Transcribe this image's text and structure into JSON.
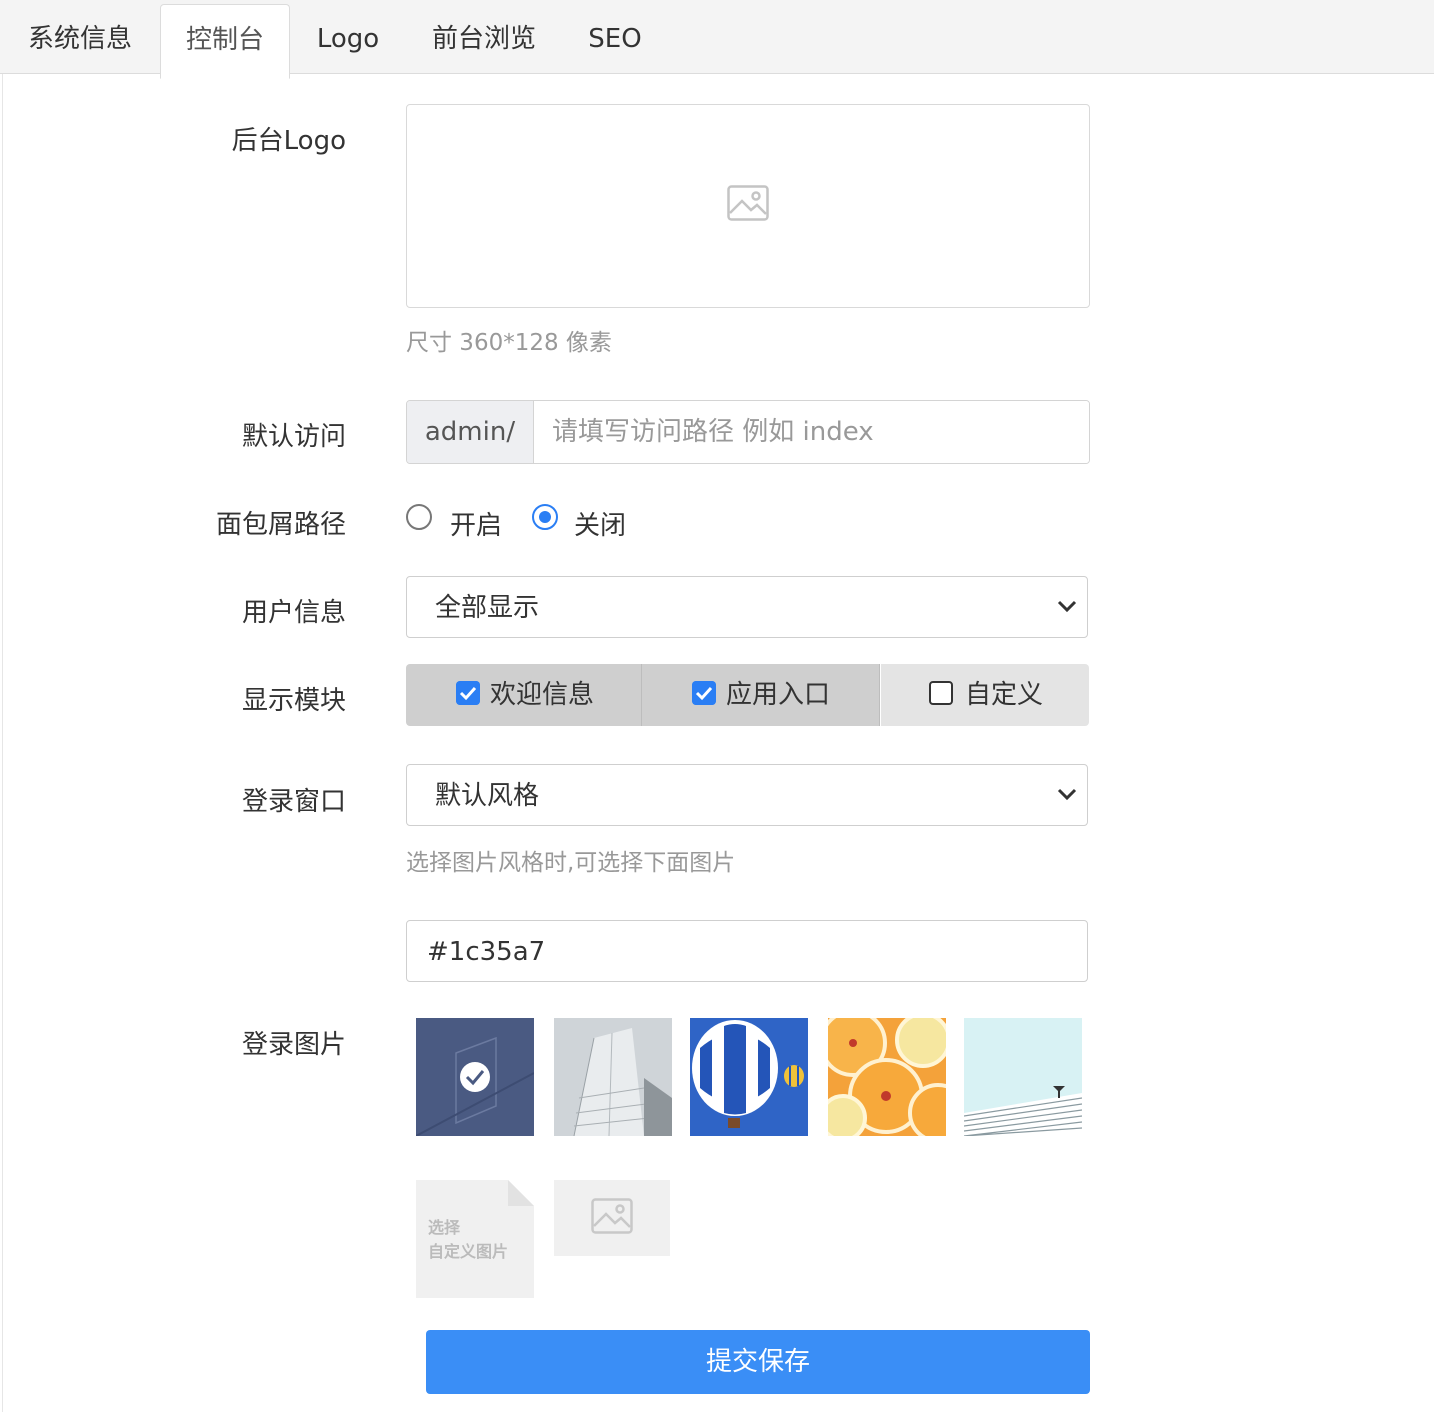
{
  "tabs": [
    {
      "label": "系统信息"
    },
    {
      "label": "控制台",
      "active": true
    },
    {
      "label": "Logo"
    },
    {
      "label": "前台浏览"
    },
    {
      "label": "SEO"
    }
  ],
  "form": {
    "logo_label": "后台Logo",
    "logo_hint": "尺寸 360*128 像素",
    "default_access_label": "默认访问",
    "default_access_prefix": "admin/",
    "default_access_placeholder": "请填写访问路径 例如 index",
    "breadcrumb_label": "面包屑路径",
    "breadcrumb_options": [
      "开启",
      "关闭"
    ],
    "breadcrumb_selected": "关闭",
    "user_info_label": "用户信息",
    "user_info_value": "全部显示",
    "modules_label": "显示模块",
    "modules": [
      {
        "label": "欢迎信息",
        "checked": true
      },
      {
        "label": "应用入口",
        "checked": true
      },
      {
        "label": "自定义",
        "checked": false
      }
    ],
    "login_window_label": "登录窗口",
    "login_window_value": "默认风格",
    "login_window_hint": "选择图片风格时,可选择下面图片",
    "color_value": "#1c35a7",
    "login_image_label": "登录图片",
    "login_images": [
      "abstract-blue",
      "skyscraper",
      "hot-air-balloon",
      "oranges",
      "roof-sky"
    ],
    "custom_image_line1": "选择",
    "custom_image_line2": "自定义图片",
    "submit_label": "提交保存"
  },
  "colors": {
    "accent": "#2a7ef4",
    "submit_bg": "#3a8ef6",
    "thumb_selected_bg": "#4a5a82"
  }
}
